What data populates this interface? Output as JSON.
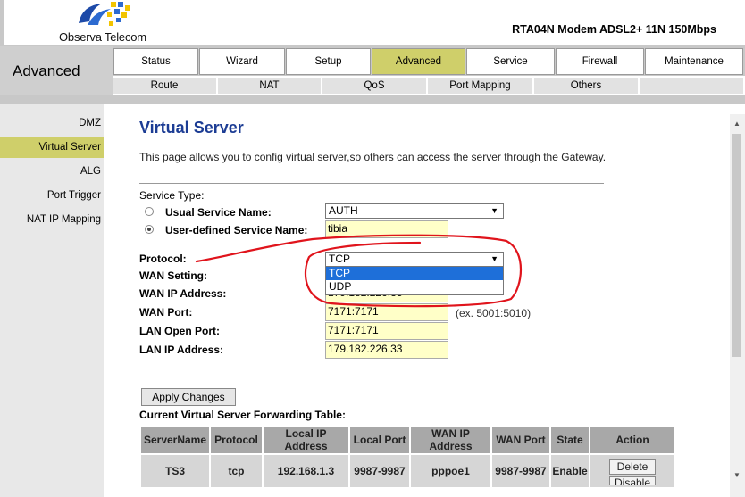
{
  "header": {
    "logo_text": "Observa Telecom",
    "product": "RTA04N Modem ADSL2+ 11N 150Mbps"
  },
  "section": {
    "title": "Advanced"
  },
  "tabs": [
    {
      "label": "Status"
    },
    {
      "label": "Wizard"
    },
    {
      "label": "Setup"
    },
    {
      "label": "Advanced",
      "active": true
    },
    {
      "label": "Service"
    },
    {
      "label": "Firewall"
    },
    {
      "label": "Maintenance"
    }
  ],
  "subtabs": [
    {
      "label": "Route"
    },
    {
      "label": "NAT"
    },
    {
      "label": "QoS"
    },
    {
      "label": "Port Mapping"
    },
    {
      "label": "Others"
    }
  ],
  "sidebar": {
    "items": [
      {
        "label": "DMZ"
      },
      {
        "label": "Virtual Server",
        "active": true
      },
      {
        "label": "ALG"
      },
      {
        "label": "Port Trigger"
      },
      {
        "label": "NAT IP Mapping"
      }
    ]
  },
  "content": {
    "title": "Virtual Server",
    "description": "This page allows you to config virtual server,so others can access the server through the Gateway.",
    "service_type_label": "Service Type:",
    "usual_service_label": "Usual Service Name:",
    "usual_service_value": "AUTH",
    "user_defined_label": "User-defined Service Name:",
    "user_defined_value": "tibia",
    "protocol_label": "Protocol:",
    "protocol_value": "TCP",
    "protocol_options": [
      "TCP",
      "UDP"
    ],
    "wan_setting_label": "WAN Setting:",
    "wan_ip_label": "WAN IP Address:",
    "wan_ip_value": "179.182.226.33",
    "wan_port_label": "WAN Port:",
    "wan_port_value": "7171:7171",
    "wan_port_hint": "(ex. 5001:5010)",
    "lan_open_port_label": "LAN Open Port:",
    "lan_open_port_value": "7171:7171",
    "lan_ip_label": "LAN IP Address:",
    "lan_ip_value": "179.182.226.33",
    "apply_label": "Apply Changes",
    "table_title": "Current Virtual Server Forwarding Table:"
  },
  "table": {
    "headers": [
      "ServerName",
      "Protocol",
      "Local IP Address",
      "Local Port",
      "WAN IP Address",
      "WAN Port",
      "State",
      "Action"
    ],
    "rows": [
      {
        "server": "TS3",
        "protocol": "tcp",
        "local_ip": "192.168.1.3",
        "local_port": "9987-9987",
        "wan_ip": "pppoe1",
        "wan_port": "9987-9987",
        "state": "Enable",
        "delete": "Delete",
        "disable": "Disable"
      }
    ]
  },
  "colors": {
    "active_tab": "#cfcf6a",
    "title_blue": "#1c3c94",
    "input_bg": "#ffffc8",
    "annotation_red": "#e0141c",
    "selected_option": "#1e6fd9"
  }
}
